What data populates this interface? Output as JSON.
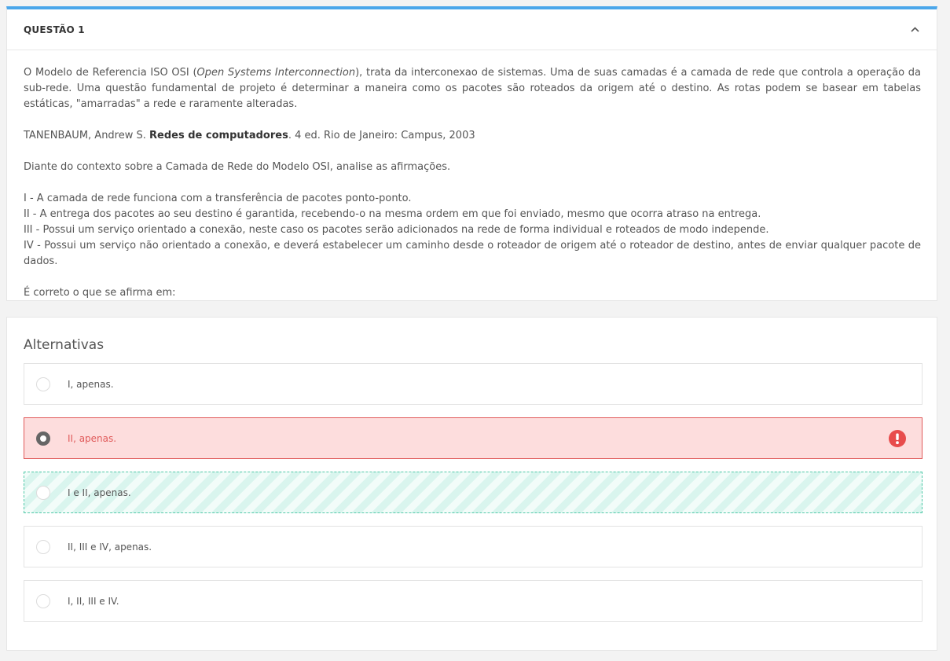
{
  "question": {
    "title": "QUESTÃO 1",
    "collapse_icon": "chevron-up-icon",
    "para1_before": "O Modelo de Referencia ISO OSI (",
    "para1_italic": "Open Systems Interconnection",
    "para1_after": "), trata da interconexao de sistemas. Uma de suas camadas é a camada de rede que controla a operação da sub-rede. Uma questão fundamental de projeto é determinar a maneira como os pacotes são roteados da origem até o destino. As rotas podem se basear em tabelas estáticas, \"amarradas\" a rede e raramente alteradas.",
    "ref_before": "TANENBAUM, Andrew S. ",
    "ref_bold": "Redes de computadores",
    "ref_after": ". 4 ed. Rio de Janeiro: Campus, 2003",
    "context": "Diante do contexto sobre a Camada de Rede do Modelo OSI, analise as afirmações.",
    "statements": [
      "I - A camada de rede funciona com a transferência de pacotes ponto-ponto.",
      "II - A entrega dos pacotes ao seu destino é garantida, recebendo-o na mesma ordem em que foi enviado, mesmo que ocorra atraso na entrega.",
      "III - Possui um serviço orientado a conexão, neste caso os pacotes serão adicionados na rede de forma individual e roteados de modo independe.",
      "IV - Possui um serviço não orientado a conexão, e deverá estabelecer um caminho desde o roteador de origem até o roteador de destino, antes de enviar qualquer pacote de dados."
    ],
    "prompt": "É correto o que se afirma em:"
  },
  "alternatives": {
    "title": "Alternativas",
    "options": [
      {
        "label": "I, apenas.",
        "state": "default"
      },
      {
        "label": "II, apenas.",
        "state": "selected-wrong"
      },
      {
        "label": "I e II, apenas.",
        "state": "correct"
      },
      {
        "label": "II, III e IV, apenas.",
        "state": "default"
      },
      {
        "label": "I, II, III e IV.",
        "state": "default"
      }
    ],
    "error_icon": "exclamation-circle-icon"
  },
  "colors": {
    "accent": "#4aa6ea",
    "wrong_bg": "#fddddd",
    "wrong_border": "#e05a5a",
    "correct_border": "#52c9a8"
  }
}
